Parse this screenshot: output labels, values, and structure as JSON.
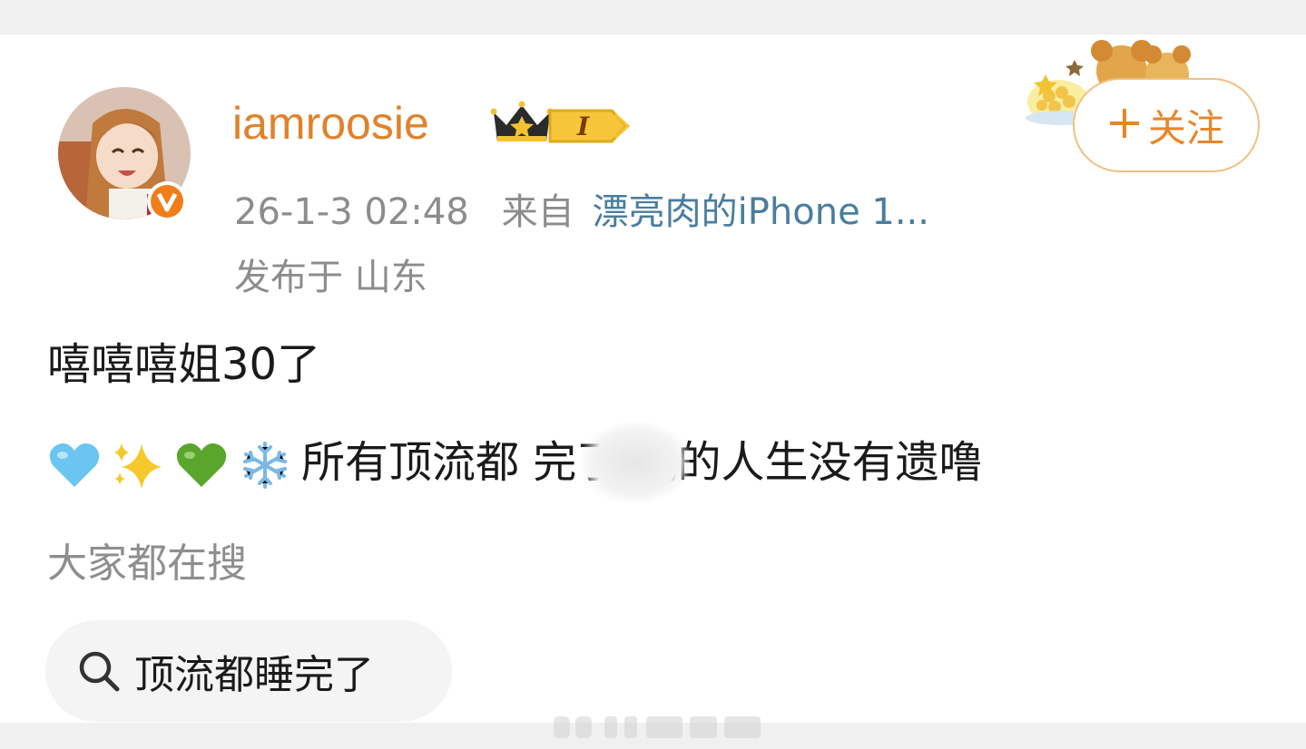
{
  "post": {
    "username": "iamroosie",
    "level_badge": "I",
    "timestamp": "26-1-3 02:48",
    "source_prefix": "来自",
    "source_device": "漂亮肉的iPhone 1...",
    "location": "发布于 山东",
    "follow_label": "关注",
    "follow_icon": "plus-icon",
    "content_line1": "嘻嘻嘻姐30了",
    "content_line2_emojis": [
      "light-blue-heart",
      "sparkles",
      "green-heart",
      "snowflake"
    ],
    "content_line2_text": "所有顶流都  完了 我的人生没有遗噜"
  },
  "search": {
    "section_label": "大家都在搜",
    "chip_text": "顶流都睡完了",
    "chip_icon": "search-icon"
  },
  "colors": {
    "username": "#e0822b",
    "link": "#4a7d9e",
    "meta": "#8c8c8c",
    "follow": "#e8862c",
    "verified_badge": "#f07d1a"
  }
}
